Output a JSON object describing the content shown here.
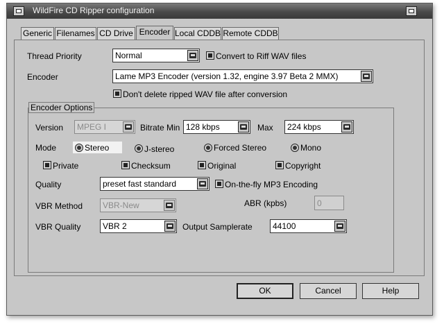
{
  "window": {
    "title": "WildFire CD Ripper configuration"
  },
  "tabs": [
    {
      "label": "Generic"
    },
    {
      "label": "Filenames"
    },
    {
      "label": "CD Drive"
    },
    {
      "label": "Encoder",
      "active": true
    },
    {
      "label": "Local CDDB"
    },
    {
      "label": "Remote CDDB"
    }
  ],
  "encoder_tab": {
    "thread_priority_label": "Thread Priority",
    "thread_priority_value": "Normal",
    "convert_riff_label": "Convert to Riff WAV files",
    "encoder_label": "Encoder",
    "encoder_value": "Lame MP3 Encoder (version 1.32, engine 3.97 Beta 2 MMX)",
    "dont_delete_label": "Don't delete ripped WAV file after conversion",
    "options_group_title": "Encoder Options",
    "version_label": "Version",
    "version_value": "MPEG I",
    "bitrate_min_label": "Bitrate Min",
    "bitrate_min_value": "128 kbps",
    "max_label": "Max",
    "max_value": "224 kbps",
    "mode_label": "Mode",
    "mode_options": [
      "Stereo",
      "J-stereo",
      "Forced Stereo",
      "Mono"
    ],
    "mode_selected": "Stereo",
    "flags": [
      "Private",
      "Checksum",
      "Original",
      "Copyright"
    ],
    "quality_label": "Quality",
    "quality_value": "preset fast standard",
    "on_the_fly_label": "On-the-fly MP3 Encoding",
    "vbr_method_label": "VBR Method",
    "vbr_method_value": "VBR-New",
    "abr_label": "ABR (kpbs)",
    "abr_value": "0",
    "vbr_quality_label": "VBR Quality",
    "vbr_quality_value": "VBR 2",
    "output_samplerate_label": "Output Samplerate",
    "output_samplerate_value": "44100"
  },
  "buttons": {
    "ok": "OK",
    "cancel": "Cancel",
    "help": "Help"
  },
  "colors": {
    "dialog_bg": "#c7c7c7",
    "titlebar": "#4a4a4a",
    "disabled_text": "#8a8a8a"
  }
}
